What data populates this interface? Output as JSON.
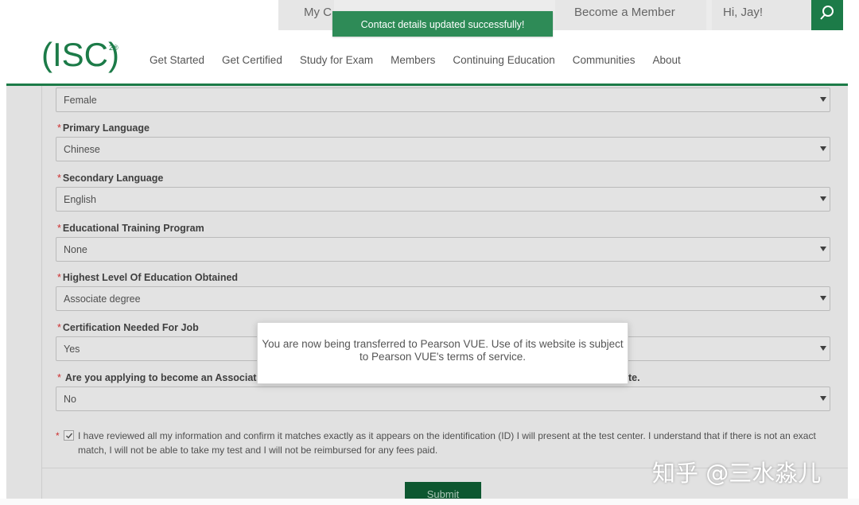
{
  "top_bar": {
    "items": [
      "My C",
      "Become a Member",
      "Hi, Jay!"
    ]
  },
  "toast": {
    "message": "Contact details updated successfully!"
  },
  "logo": {
    "text": "(ISC)",
    "sup": "2®"
  },
  "nav": {
    "items": [
      "Get Started",
      "Get Certified",
      "Study for Exam",
      "Members",
      "Continuing Education",
      "Communities",
      "About"
    ]
  },
  "form": {
    "fields": [
      {
        "label": "",
        "value": "Female"
      },
      {
        "label": "Primary Language",
        "value": "Chinese"
      },
      {
        "label": "Secondary Language",
        "value": "English"
      },
      {
        "label": "Educational Training Program",
        "value": "None"
      },
      {
        "label": "Highest Level Of Education Obtained",
        "value": "Associate degree"
      },
      {
        "label": "Certification Needed For Job",
        "value": "Yes"
      },
      {
        "label": "Are you applying to become an Associat",
        "label_tail": "te.",
        "value": "No"
      }
    ],
    "required_mark": "*",
    "agreement": "I have reviewed all my information and confirm it matches exactly as it appears on the identification (ID) I will present at the test center. I understand that if there is not an exact match, I will not be able to take my test and I will not be reimbursed for any fees paid.",
    "submit_label": "Submit"
  },
  "modal": {
    "message": "You are now being transferred to Pearson VUE. Use of its website is subject to Pearson VUE's terms of service."
  },
  "watermark": {
    "text": "知乎 @三水淼儿"
  },
  "colors": {
    "brand_green": "#1c7b48",
    "toast_green": "#2e8b57",
    "required_red": "#d33333"
  }
}
